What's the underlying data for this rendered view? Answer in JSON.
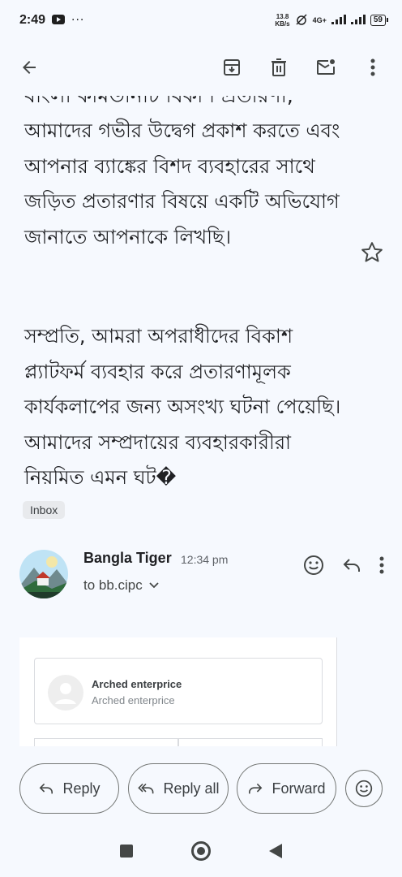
{
  "status_bar": {
    "time": "2:49",
    "dots": "···",
    "netspeed_value": "13.8",
    "netspeed_unit": "KB/s",
    "network": "4G+",
    "battery": "59"
  },
  "email": {
    "clipped_line": "বাংলা কমিউনিটি বিকাশ প্রতারণা,",
    "para1": "আমাদের গভীর উদ্বেগ প্রকাশ করতে এবং আপনার ব্যাঙ্কের বিশদ ব্যবহারের সাথে জড়িত প্রতারণার বিষয়ে একটি অভিযোগ জানাতে আপনাকে লিখছি।",
    "para2": "সম্প্রতি, আমরা অপরাধীদের বিকাশ প্ল্যাটফর্ম ব্যবহার করে প্রতারণামূলক কার্যকলাপের জন্য অসংখ্য ঘটনা পেয়েছি। আমাদের সম্প্রদায়ের ব্যবহারকারীরা নিয়মিত এমন ঘট�",
    "label": "Inbox"
  },
  "sender": {
    "name": "Bangla Tiger",
    "time": "12:34 pm",
    "recipient": "to bb.cipc"
  },
  "preview": {
    "title": "Arched enterprice",
    "subtitle": "Arched enterprice"
  },
  "actions": {
    "reply": "Reply",
    "reply_all": "Reply all",
    "forward": "Forward"
  },
  "colors": {
    "background": "#f6f9fe",
    "text": "#202124",
    "border": "#747775"
  }
}
